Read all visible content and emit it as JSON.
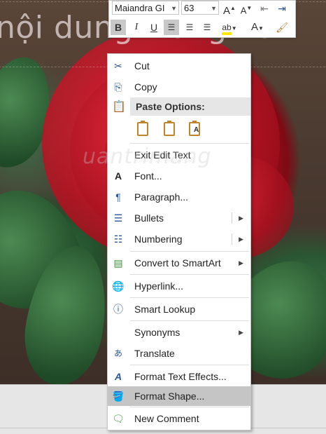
{
  "slide": {
    "title_text": "nội dung trong Po"
  },
  "toolbar": {
    "font_name": "Maiandra GI",
    "font_size": "63",
    "grow_font": "A",
    "shrink_font": "A",
    "bold": "B",
    "italic": "I",
    "underline": "U",
    "highlight_label": "ab",
    "font_color_label": "A"
  },
  "menu": {
    "cut": "Cut",
    "copy": "Copy",
    "paste_header": "Paste Options:",
    "paste_opts": [
      "",
      "",
      "A"
    ],
    "exit_edit": "Exit Edit Text",
    "font": "Font...",
    "paragraph": "Paragraph...",
    "bullets": "Bullets",
    "numbering": "Numbering",
    "smartart": "Convert to SmartArt",
    "hyperlink": "Hyperlink...",
    "smart_lookup": "Smart Lookup",
    "synonyms": "Synonyms",
    "translate": "Translate",
    "text_effects": "Format Text Effects...",
    "format_shape": "Format Shape...",
    "new_comment": "New Comment"
  },
  "watermark": "uantrimang",
  "colors": {
    "accent": "#2b5797",
    "highlight": "#c5c5c5",
    "paste_icon": "#c0852a"
  }
}
